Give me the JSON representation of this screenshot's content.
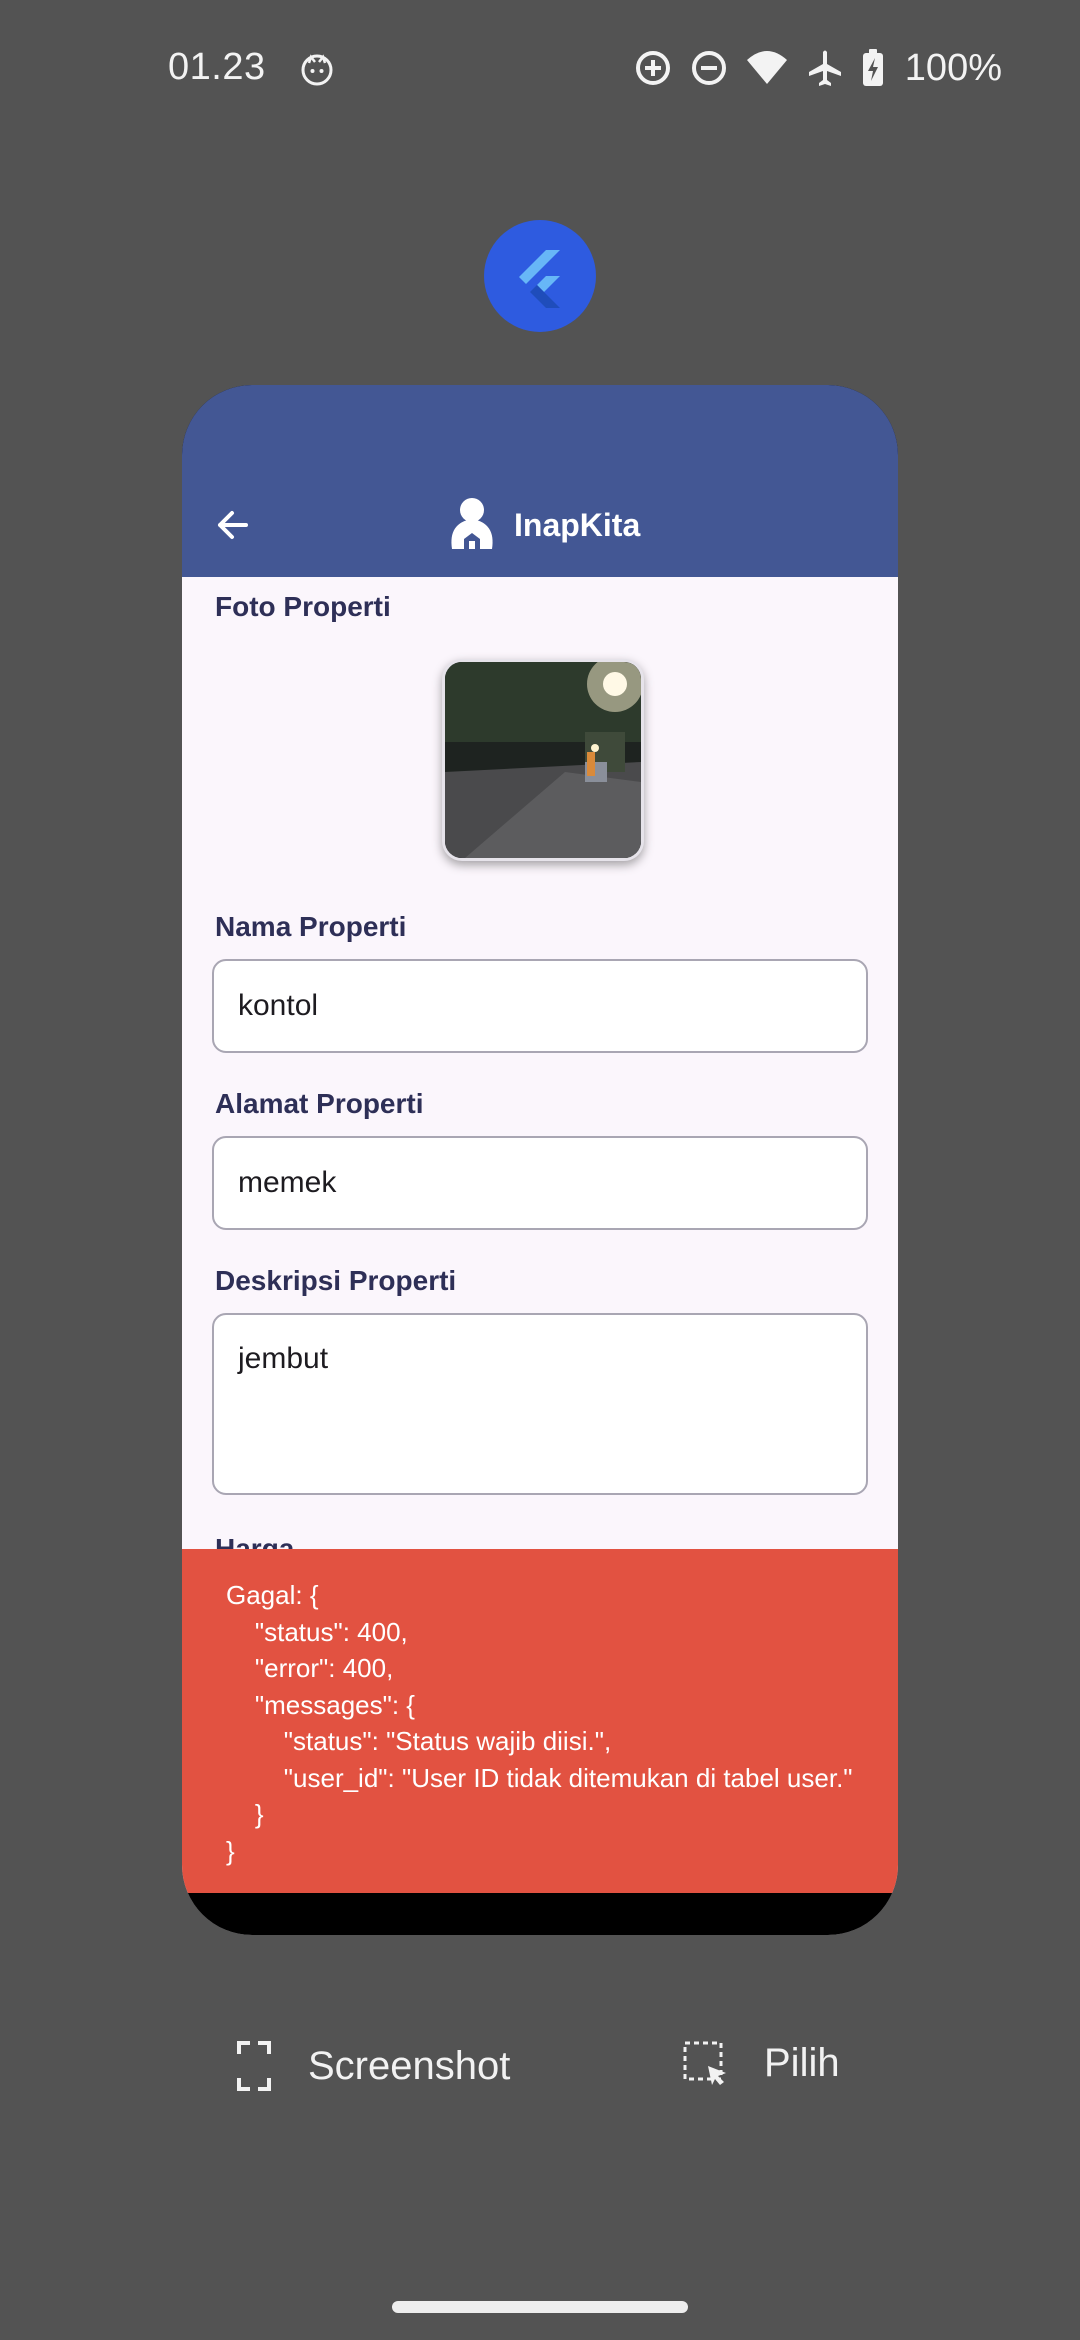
{
  "status_bar": {
    "time": "01.23",
    "battery": "100%",
    "icons": [
      "cat-notification-icon",
      "data-saver-icon",
      "do-not-disturb-icon",
      "wifi-icon",
      "airplane-icon",
      "battery-charging-icon"
    ]
  },
  "launcher": {
    "icon": "flutter-icon"
  },
  "app": {
    "title": "InapKita",
    "back_icon": "back-arrow-icon",
    "logo_icon": "inapkita-logo-icon",
    "colors": {
      "appbar": "#435794",
      "background": "#fbf6fc",
      "snackbar": "#e25241",
      "label": "#2e2f57"
    }
  },
  "form": {
    "photo_label": "Foto Properti",
    "name_label": "Nama Properti",
    "name_value": "kontol",
    "address_label": "Alamat Properti",
    "address_value": "memek",
    "description_label": "Deskripsi Properti",
    "description_value": "jembut",
    "price_label": "Harga"
  },
  "snackbar": {
    "message": "Gagal: {\n    \"status\": 400,\n    \"error\": 400,\n    \"messages\": {\n        \"status\": \"Status wajib diisi.\",\n        \"user_id\": \"User ID tidak ditemukan di tabel user.\"\n    }\n}"
  },
  "actions": {
    "screenshot_label": "Screenshot",
    "screenshot_icon": "screenshot-frame-icon",
    "select_label": "Pilih",
    "select_icon": "select-region-icon"
  }
}
